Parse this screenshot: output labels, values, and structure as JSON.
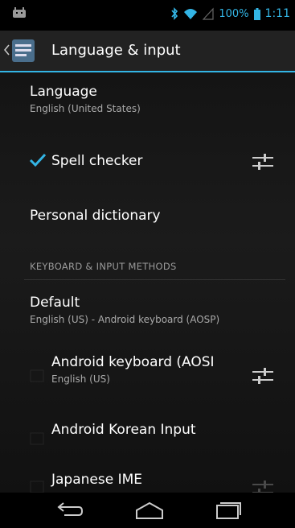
{
  "status_bar": {
    "battery_percent": "100%",
    "time": "1:11",
    "accent": "#33b5e5"
  },
  "action_bar": {
    "title": "Language & input"
  },
  "items": {
    "language": {
      "title": "Language",
      "subtitle": "English (United States)"
    },
    "spell_checker": {
      "title": "Spell checker",
      "checked": true
    },
    "personal_dictionary": {
      "title": "Personal dictionary"
    },
    "section_header": "KEYBOARD & INPUT METHODS",
    "default": {
      "title": "Default",
      "subtitle": "English (US) - Android keyboard (AOSP)"
    },
    "android_keyboard": {
      "title": "Android keyboard (AOSI",
      "subtitle": "English (US)"
    },
    "korean_input": {
      "title": "Android Korean Input"
    },
    "japanese_ime": {
      "title": "Japanese IME"
    }
  },
  "icons": {
    "statusbar_left": "android-debug-icon",
    "bluetooth": "bluetooth-icon",
    "wifi": "wifi-icon",
    "signal": "signal-icon",
    "battery": "battery-icon",
    "settings": "settings-sliders-icon",
    "nav_back": "back-icon",
    "nav_home": "home-icon",
    "nav_recents": "recents-icon"
  }
}
